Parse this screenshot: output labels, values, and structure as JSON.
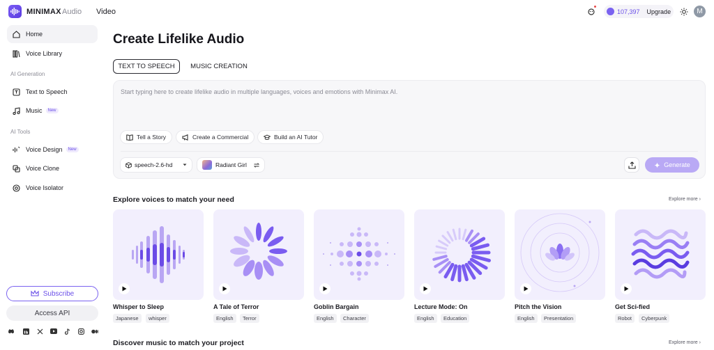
{
  "topbar": {
    "brand": "MINIMAX",
    "brand_sub": "Audio",
    "nav_video": "Video",
    "credits": "107,397",
    "upgrade": "Upgrade",
    "avatar_initial": "M"
  },
  "sidebar": {
    "home": "Home",
    "voice_library": "Voice Library",
    "section_ai_generation": "AI Generation",
    "text_to_speech": "Text to Speech",
    "music": "Music",
    "music_badge": "New",
    "section_ai_tools": "AI Tools",
    "voice_design": "Voice Design",
    "voice_design_badge": "New",
    "voice_clone": "Voice Clone",
    "voice_isolator": "Voice Isolator",
    "subscribe": "Subscribe",
    "access_api": "Access API",
    "social_icons": [
      "discord-icon",
      "linkedin-icon",
      "x-icon",
      "youtube-icon",
      "tiktok-icon",
      "instagram-icon",
      "medium-icon"
    ]
  },
  "main": {
    "title": "Create Lifelike Audio",
    "tabs": [
      {
        "label": "TEXT TO SPEECH"
      },
      {
        "label": "MUSIC CREATION"
      }
    ],
    "editor": {
      "placeholder": "Start typing here to create lifelike audio in multiple languages, voices and emotions with Minimax AI.",
      "chips": [
        {
          "label": "Tell a Story"
        },
        {
          "label": "Create a Commercial"
        },
        {
          "label": "Build an AI Tutor"
        }
      ],
      "model": "speech-2.6-hd",
      "voice": "Radiant Girl",
      "generate": "Generate"
    },
    "explore_title": "Explore voices to match your need",
    "explore_more": "Explore more",
    "voices": [
      {
        "name": "Whisper to Sleep",
        "tags": [
          "Japanese",
          "whisper"
        ]
      },
      {
        "name": "A Tale of Terror",
        "tags": [
          "English",
          "Terror"
        ]
      },
      {
        "name": "Goblin Bargain",
        "tags": [
          "English",
          "Character"
        ]
      },
      {
        "name": "Lecture Mode: On",
        "tags": [
          "English",
          "Education"
        ]
      },
      {
        "name": "Pitch the Vision",
        "tags": [
          "English",
          "Presentation"
        ]
      },
      {
        "name": "Get Sci-fied",
        "tags": [
          "Robot",
          "Cyberpunk"
        ]
      }
    ],
    "music_title": "Discover music to match your project",
    "music_explore_more": "Explore more"
  },
  "colors": {
    "accent": "#6a4fe8",
    "card_bg": "#f2effd",
    "generate_disabled": "#b9a9f5"
  }
}
